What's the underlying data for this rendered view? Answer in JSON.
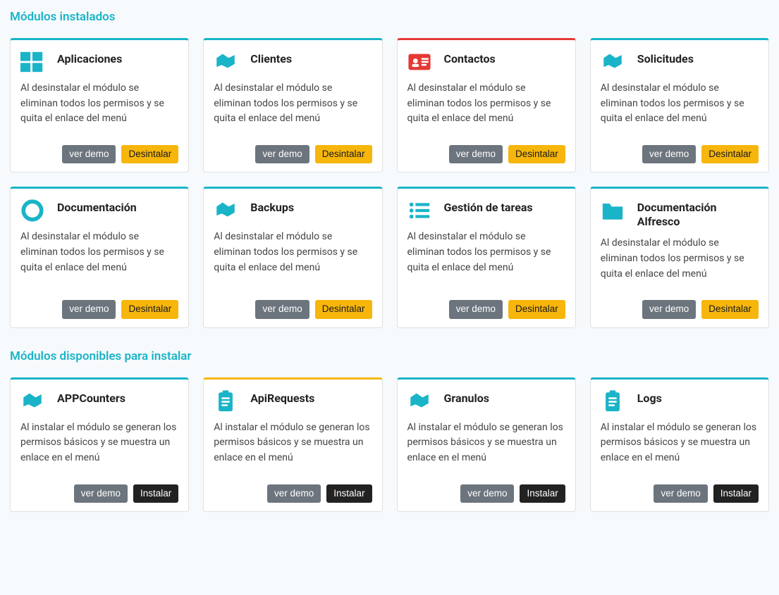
{
  "sections": {
    "installed": {
      "title": "Módulos instalados",
      "uninstall_desc": "Al desinstalar el módulo se eliminan todos los permisos y se quita el enlace del menú",
      "items": [
        {
          "name": "Aplicaciones",
          "icon": "windows",
          "top": "#1AB4C8"
        },
        {
          "name": "Clientes",
          "icon": "handshake",
          "top": "#1AB4C8"
        },
        {
          "name": "Contactos",
          "icon": "id-card",
          "top": "#e53935",
          "iconColor": "red"
        },
        {
          "name": "Solicitudes",
          "icon": "handshake",
          "top": "#1AB4C8"
        },
        {
          "name": "Documentación",
          "icon": "circle",
          "top": "#1AB4C8"
        },
        {
          "name": "Backups",
          "icon": "handshake",
          "top": "#1AB4C8"
        },
        {
          "name": "Gestión de tareas",
          "icon": "list",
          "top": "#1AB4C8"
        },
        {
          "name": "Documentación Alfresco",
          "icon": "folder",
          "top": "#1AB4C8"
        }
      ]
    },
    "available": {
      "title": "Módulos disponibles para instalar",
      "install_desc": "Al instalar el módulo se generan los permisos básicos y se muestra un enlace en el menú",
      "items": [
        {
          "name": "APPCounters",
          "icon": "handshake",
          "top": "#1AB4C8"
        },
        {
          "name": "ApiRequests",
          "icon": "clipboard",
          "top": "#f6b60b"
        },
        {
          "name": "Granulos",
          "icon": "handshake",
          "top": "#1AB4C8"
        },
        {
          "name": "Logs",
          "icon": "clipboard",
          "top": "#1AB4C8"
        }
      ]
    }
  },
  "buttons": {
    "demo": "ver demo",
    "uninstall": "Desintalar",
    "install": "Instalar"
  }
}
